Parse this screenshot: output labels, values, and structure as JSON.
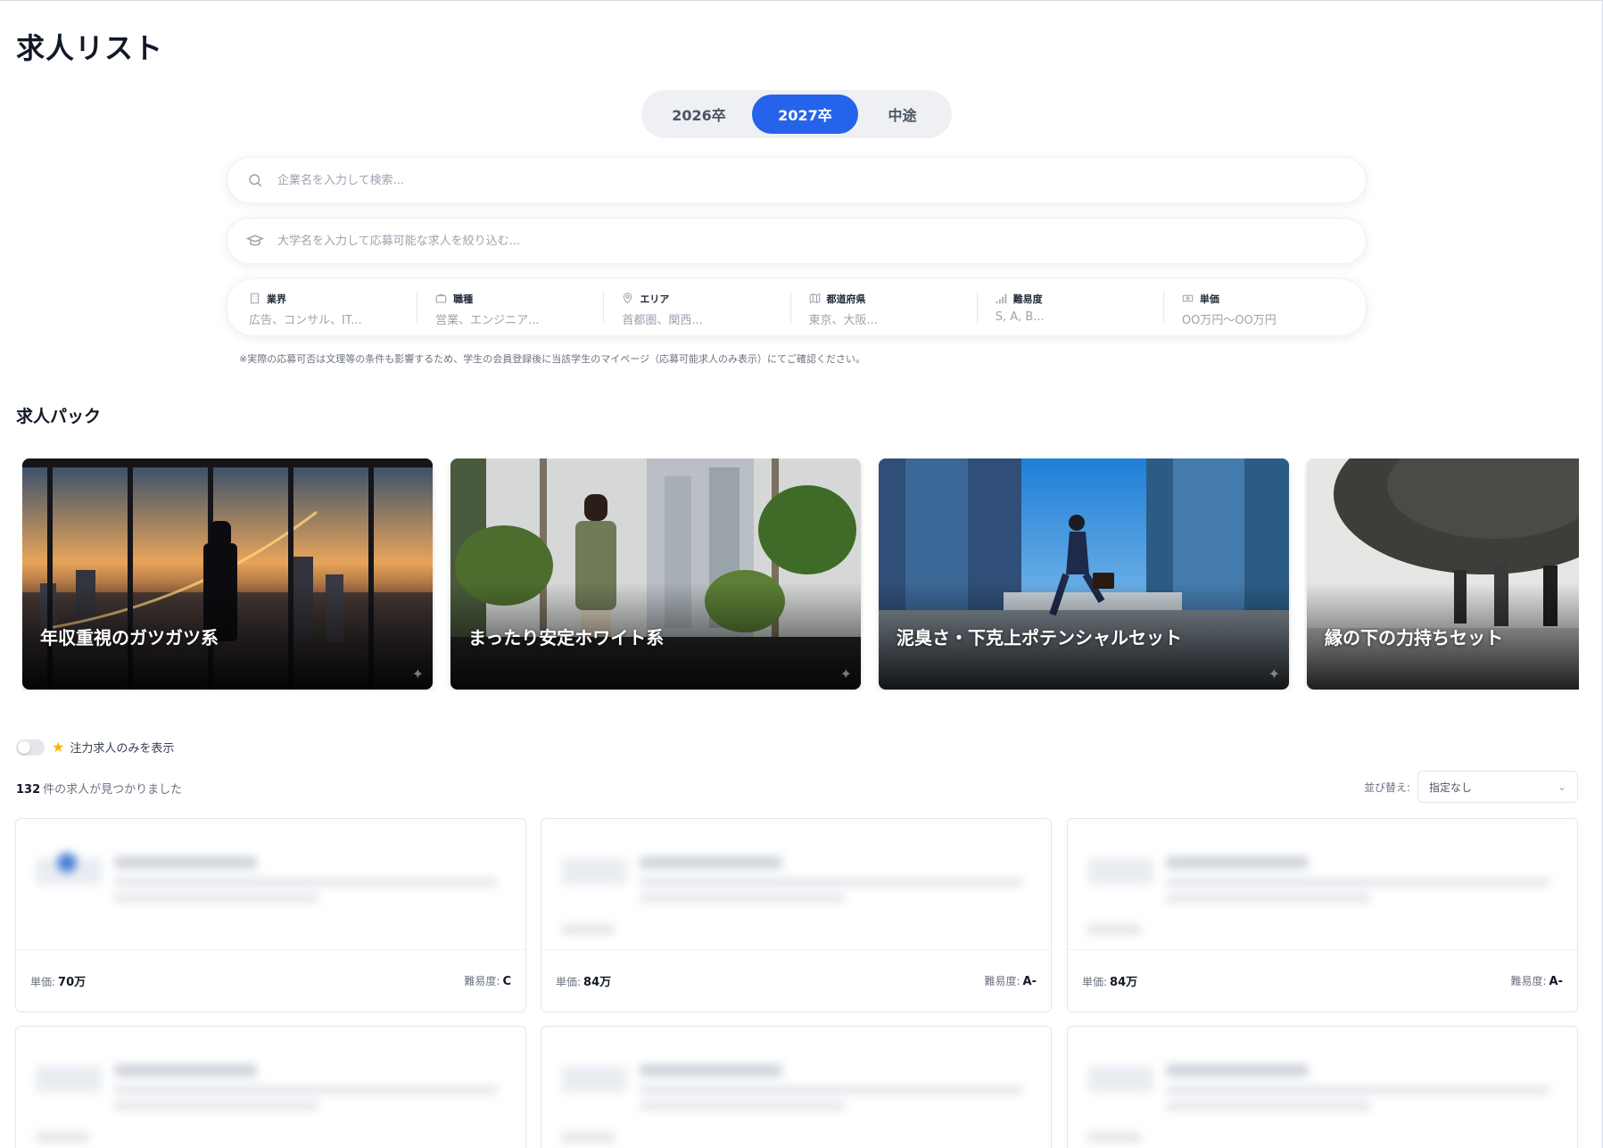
{
  "page_title": "求人リスト",
  "grad_tabs": [
    {
      "label": "2026卒",
      "active": false
    },
    {
      "label": "2027卒",
      "active": true
    },
    {
      "label": "中途",
      "active": false
    }
  ],
  "search": {
    "company_placeholder": "企業名を入力して検索...",
    "university_placeholder": "大学名を入力して応募可能な求人を絞り込む..."
  },
  "filters": [
    {
      "icon": "building-icon",
      "label": "業界",
      "value": "広告、コンサル、IT..."
    },
    {
      "icon": "briefcase-icon",
      "label": "職種",
      "value": "営業、エンジニア..."
    },
    {
      "icon": "location-pin-icon",
      "label": "エリア",
      "value": "首都圏、関西..."
    },
    {
      "icon": "map-icon",
      "label": "都道府県",
      "value": "東京、大阪..."
    },
    {
      "icon": "signal-bars-icon",
      "label": "難易度",
      "value": "S, A, B..."
    },
    {
      "icon": "banknote-icon",
      "label": "単価",
      "value": "OO万円〜OO万円"
    }
  ],
  "note": "※実際の応募可否は文理等の条件も影響するため、学生の会員登録後に当該学生のマイページ（応募可能求人のみ表示）にてご確認ください。",
  "packs_title": "求人パック",
  "packs": [
    {
      "title": "年収重視のガツガツ系"
    },
    {
      "title": "まったり安定ホワイト系"
    },
    {
      "title": "泥臭さ・下克上ポテンシャルセット"
    },
    {
      "title": "縁の下の力持ちセット"
    }
  ],
  "featured_toggle": {
    "label": "注力求人のみを表示",
    "on": false
  },
  "results": {
    "count": "132",
    "suffix": "件の求人が見つかりました"
  },
  "sort": {
    "label": "並び替え:",
    "value": "指定なし"
  },
  "jobs": [
    {
      "price_label": "単価:",
      "price": "70万",
      "difficulty_label": "難易度:",
      "difficulty": "C"
    },
    {
      "price_label": "単価:",
      "price": "84万",
      "difficulty_label": "難易度:",
      "difficulty": "A-"
    },
    {
      "price_label": "単価:",
      "price": "84万",
      "difficulty_label": "難易度:",
      "difficulty": "A-"
    }
  ],
  "colors": {
    "accent": "#2563eb",
    "star": "#f5b60b"
  }
}
